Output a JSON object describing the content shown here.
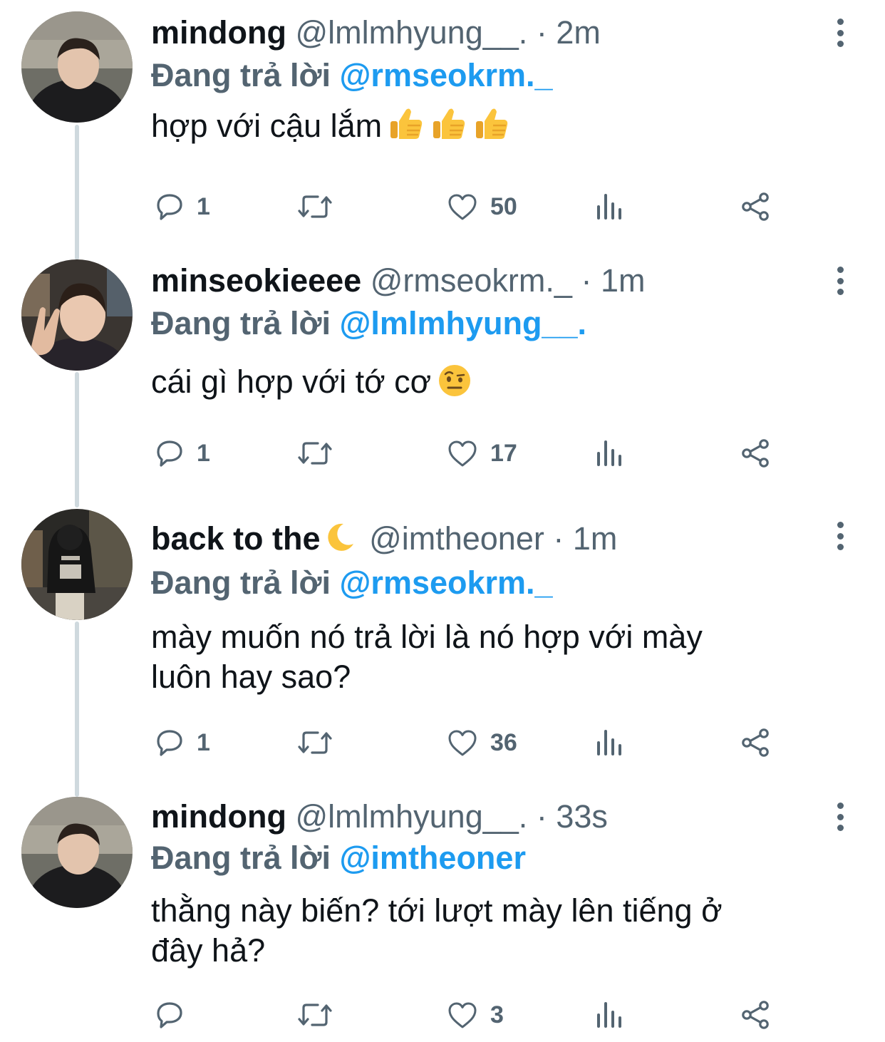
{
  "tweets": [
    {
      "display_name": "mindong",
      "handle": "@lmlmhyung__.",
      "separator": "·",
      "time": "2m",
      "reply_label": "Đang trả lời",
      "reply_mention": "@rmseokrm._",
      "text": "hợp với cậu lắm",
      "emoji": [
        "thumbs-up",
        "thumbs-up",
        "thumbs-up"
      ],
      "replies": "1",
      "retweets": "",
      "likes": "50"
    },
    {
      "display_name": "minseokieeee",
      "handle": "@rmseokrm._",
      "separator": "·",
      "time": "1m",
      "reply_label": "Đang trả lời",
      "reply_mention": "@lmlmhyung__.",
      "text": "cái gì hợp với tớ cơ",
      "emoji": [
        "face-with-raised-eyebrow"
      ],
      "replies": "1",
      "retweets": "",
      "likes": "17"
    },
    {
      "display_name": "back to the",
      "display_name_emoji": "crescent-moon",
      "handle": "@imtheoner",
      "separator": "·",
      "time": "1m",
      "reply_label": "Đang trả lời",
      "reply_mention": "@rmseokrm._",
      "text_line1": "mày muốn nó trả lời là nó hợp với mày",
      "text_line2": "luôn hay sao?",
      "replies": "1",
      "retweets": "",
      "likes": "36"
    },
    {
      "display_name": "mindong",
      "handle": "@lmlmhyung__.",
      "separator": "·",
      "time": "33s",
      "reply_label": "Đang trả lời",
      "reply_mention": "@imtheoner",
      "text_line1": "thằng này biến? tới lượt mày lên tiếng ở",
      "text_line2": "đây hả?",
      "replies": "",
      "retweets": "",
      "likes": "3"
    }
  ],
  "colors": {
    "text_primary": "#0f1419",
    "text_secondary": "#536471",
    "mention": "#1d9bf0",
    "thread_line": "#cfd9de"
  },
  "icons": [
    "reply-icon",
    "retweet-icon",
    "heart-icon",
    "views-icon",
    "share-icon",
    "more-icon"
  ]
}
